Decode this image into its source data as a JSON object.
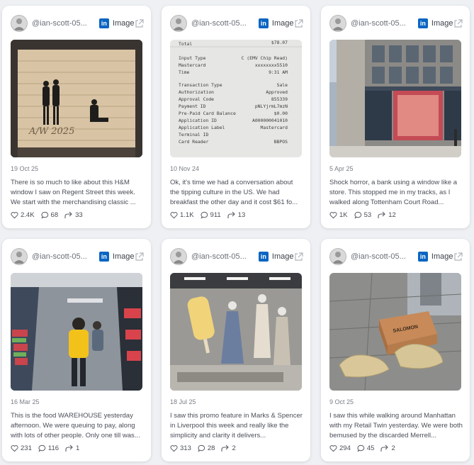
{
  "posts": [
    {
      "handle": "@ian-scott-05...",
      "network_badge": "in",
      "type": "Image",
      "date": "19 Oct 25",
      "text": "There is so much to like about this H&M window I saw on Regent Street this week. We start with the merchandising classic ...",
      "likes": "2.4K",
      "comments": "68",
      "shares": "33",
      "image_caption": "A/W 2025"
    },
    {
      "handle": "@ian-scott-05...",
      "network_badge": "in",
      "type": "Image",
      "date": "10 Nov 24",
      "text": "Ok, it's time we had a conversation about the tipping culture in the US. We had breakfast the other day and it cost $61 fo...",
      "likes": "1.1K",
      "comments": "911",
      "shares": "13",
      "receipt": {
        "total_label": "Total",
        "total_value": "$78.07",
        "rows": [
          [
            "Input Type",
            "C (EMV Chip Read)"
          ],
          [
            "Mastercard",
            "xxxxxxxx5510"
          ],
          [
            "Time",
            "9:31 AM"
          ],
          [
            "",
            ""
          ],
          [
            "Transaction Type",
            "Sale"
          ],
          [
            "Authorization",
            "Approved"
          ],
          [
            "Approval Code",
            "855339"
          ],
          [
            "Payment ID",
            "pNLYjrmL7mzN"
          ],
          [
            "Pre-Paid Card Balance",
            "$0.00"
          ],
          [
            "Application ID",
            "A000000041010"
          ],
          [
            "Application Label",
            "Mastercard"
          ],
          [
            "Terminal ID",
            ""
          ],
          [
            "Card Reader",
            "BBPOS"
          ]
        ]
      }
    },
    {
      "handle": "@ian-scott-05...",
      "network_badge": "in",
      "type": "Image",
      "date": "5 Apr 25",
      "text": "Shock horror, a bank using a window like a store. This stopped me in my tracks, as I walked along Tottenham Court Road...",
      "likes": "1K",
      "comments": "53",
      "shares": "12"
    },
    {
      "handle": "@ian-scott-05...",
      "network_badge": "in",
      "type": "Image",
      "date": "16 Mar 25",
      "text": "This is the food WAREHOUSE yesterday afternoon. We were queuing to pay, along with lots of other people. Only one till was...",
      "likes": "231",
      "comments": "116",
      "shares": "1"
    },
    {
      "handle": "@ian-scott-05...",
      "network_badge": "in",
      "type": "Image",
      "date": "18 Jul 25",
      "text": "I saw this promo feature in Marks & Spencer in Liverpool this week and really like the simplicity and clarity it delivers...",
      "likes": "313",
      "comments": "28",
      "shares": "2"
    },
    {
      "handle": "@ian-scott-05...",
      "network_badge": "in",
      "type": "Image",
      "date": "9 Oct 25",
      "text": "I saw this while walking around Manhattan with my Retail Twin yesterday. We were both bemused by the discarded Merrell...",
      "likes": "294",
      "comments": "45",
      "shares": "2",
      "image_caption": "SALOMON"
    }
  ],
  "colors": {
    "linkedin": "#0a66c2",
    "page_bg": "#eef0f4",
    "card_bg": "#ffffff"
  },
  "icons": [
    "avatar",
    "linkedin-icon",
    "external-link-icon",
    "heart-icon",
    "comment-icon",
    "share-icon"
  ]
}
